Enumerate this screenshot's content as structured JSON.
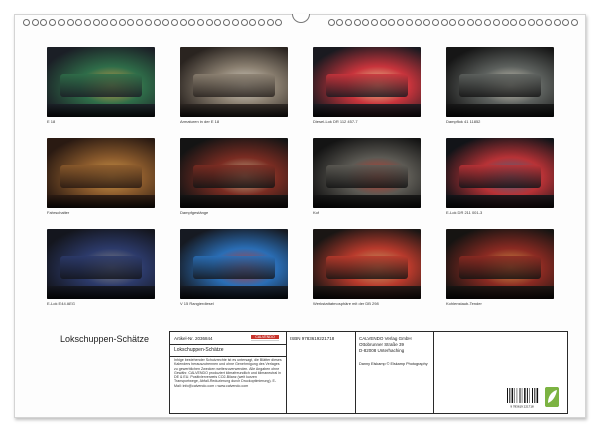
{
  "colors": {
    "background": "#ffffff",
    "sheet": "#fdfdfd",
    "border": "#2a2a2a",
    "logo_red": "#c8342c",
    "leaf_green": "#7cb342"
  },
  "photos": [
    {
      "caption": "E 18",
      "palette": [
        "#1b1f26",
        "#2f6d49",
        "#d6a24a"
      ]
    },
    {
      "caption": "Armaturen in der E 18",
      "palette": [
        "#2a2420",
        "#8a7f70",
        "#d8d2c6"
      ]
    },
    {
      "caption": "Diesel-Lok DR 112 457-7",
      "palette": [
        "#1a1a20",
        "#c8343c",
        "#f2d89a"
      ]
    },
    {
      "caption": "Dampflok 41 11852",
      "palette": [
        "#161616",
        "#5d615e",
        "#d7d2c2"
      ]
    },
    {
      "caption": "Fahrschalter",
      "palette": [
        "#2a1a12",
        "#8a5a2c",
        "#d19a4a"
      ]
    },
    {
      "caption": "Dampfgestänge",
      "palette": [
        "#141414",
        "#7a2c22",
        "#c9b48e"
      ]
    },
    {
      "caption": "Kof",
      "palette": [
        "#141414",
        "#5c5a54",
        "#c83a2c"
      ]
    },
    {
      "caption": "E-Lok DR 211 001-3",
      "palette": [
        "#121418",
        "#b83236",
        "#3a6e8a"
      ]
    },
    {
      "caption": "E-Lok E44 AEG",
      "palette": [
        "#14161e",
        "#2c3a6a",
        "#8a8a8a"
      ]
    },
    {
      "caption": "V 15 Rangierdiesel",
      "palette": [
        "#161a22",
        "#2a6eb6",
        "#c83a2c"
      ]
    },
    {
      "caption": "Werkstattatmosphäre mit der DB 298",
      "palette": [
        "#1a1614",
        "#b83a2c",
        "#c9a46a"
      ]
    },
    {
      "caption": "Kohlenstaub-Tender",
      "palette": [
        "#161412",
        "#8a2a22",
        "#d89a4a"
      ]
    }
  ],
  "title": "Lokschuppen-Schätze",
  "info": {
    "article_label": "Artikel-Nr. 2036844",
    "logo_text": "CALVENDO",
    "title_repeat": "Lokschuppen-Schätze",
    "description": "Inhige bestehender Schutzrechte ist es untersagt, die Blätter dieses Kalenders herauszutrennen und ohne Genehmigung des Verlages zu gewerblichen Zwecken weiterzuverwenden. Alle Angaben ohne Gewähr. CALVENDO produziert klimafreundlich und klimaneutral in DE & EU. Positivlerverweis CO2-Bilanz (weit kurzen Transportwege, Abfall-Reduzierung durch Druckoptimierung). E-Mail: info@calvendo.com • www.calvendo.com",
    "isbn": "ISBN 9783619221718",
    "publisher": [
      "CALVENDO Verlag GmbH",
      "Ottobrunner Straße 39",
      "D-82008 Unterhaching"
    ],
    "photographer": "Danny Elskamp © Elskamp Photography",
    "barcode_number": "9 783619 221718"
  }
}
